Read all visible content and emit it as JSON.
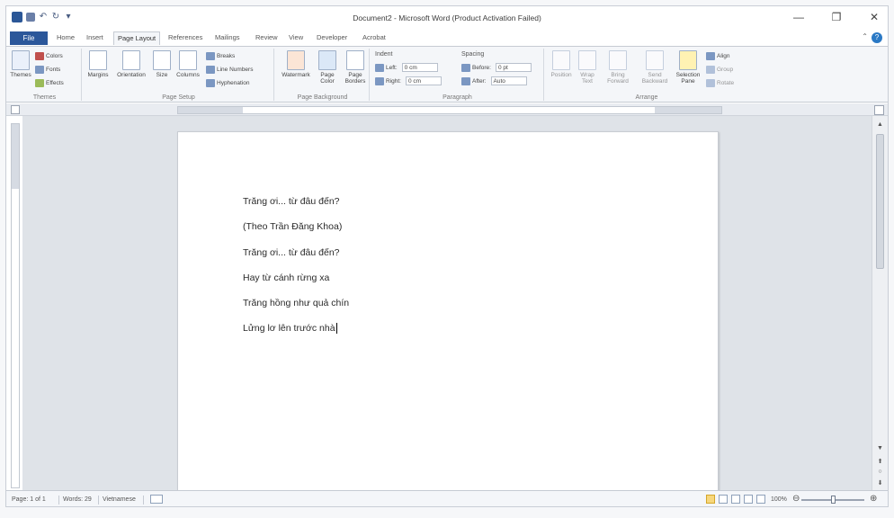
{
  "window": {
    "title": "Document2 - Microsoft Word (Product Activation Failed)",
    "minimize": "—",
    "restore": "❐",
    "close": "✕"
  },
  "menu": {
    "file": "File",
    "tabs": [
      "Home",
      "Insert",
      "Page Layout",
      "References",
      "Mailings",
      "Review",
      "View",
      "Developer",
      "Acrobat"
    ],
    "active_tab": "Page Layout"
  },
  "ribbon": {
    "themes": {
      "themes": "Themes",
      "colors": "Colors",
      "fonts": "Fonts",
      "effects": "Effects",
      "group": "Themes"
    },
    "page_setup": {
      "margins": "Margins",
      "orientation": "Orientation",
      "size": "Size",
      "columns": "Columns",
      "breaks": "Breaks",
      "line_numbers": "Line Numbers",
      "hyphenation": "Hyphenation",
      "group": "Page Setup"
    },
    "page_background": {
      "watermark": "Watermark",
      "page_color": "Page Color",
      "page_borders": "Page Borders",
      "group": "Page Background"
    },
    "paragraph": {
      "indent": "Indent",
      "left_label": "Left:",
      "left_value": "0 cm",
      "right_label": "Right:",
      "right_value": "0 cm",
      "spacing": "Spacing",
      "before_label": "Before:",
      "before_value": "0 pt",
      "after_label": "After:",
      "after_value": "Auto",
      "group": "Paragraph"
    },
    "arrange": {
      "position": "Position",
      "wrap_text": "Wrap Text",
      "bring_forward": "Bring Forward",
      "send_backward": "Send Backward",
      "selection_pane": "Selection Pane",
      "align": "Align",
      "group_btn": "Group",
      "rotate": "Rotate",
      "group": "Arrange"
    }
  },
  "document": {
    "lines": [
      "Trăng ơi... từ đâu đến?",
      "(Theo Trần Đăng Khoa)",
      "Trăng ơi... từ đâu đến?",
      "Hay từ cánh rừng xa",
      "Trăng hồng như quả chín",
      "Lửng lơ lên trước nhà"
    ]
  },
  "status": {
    "page": "Page: 1 of 1",
    "words": "Words: 29",
    "language": "Vietnamese",
    "zoom": "100%"
  },
  "icons": [
    "save-icon",
    "undo-icon",
    "redo-icon",
    "help-icon",
    "view-ruler-icon",
    "scroll-up-icon",
    "scroll-down-icon",
    "proofing-icon"
  ]
}
